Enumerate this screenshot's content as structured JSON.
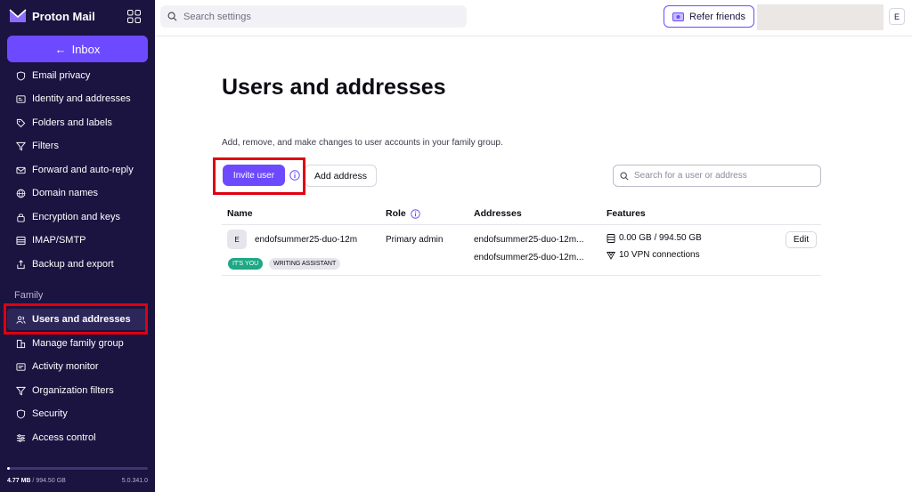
{
  "brand": {
    "name": "Proton Mail"
  },
  "sidebar": {
    "inbox_label": "Inbox",
    "items": [
      {
        "label": "Email privacy",
        "icon": "shield-icon"
      },
      {
        "label": "Identity and addresses",
        "icon": "id-card-icon"
      },
      {
        "label": "Folders and labels",
        "icon": "tag-icon"
      },
      {
        "label": "Filters",
        "icon": "filter-icon"
      },
      {
        "label": "Forward and auto-reply",
        "icon": "envelope-icon"
      },
      {
        "label": "Domain names",
        "icon": "globe-icon"
      },
      {
        "label": "Encryption and keys",
        "icon": "lock-icon"
      },
      {
        "label": "IMAP/SMTP",
        "icon": "server-icon"
      },
      {
        "label": "Backup and export",
        "icon": "export-icon"
      }
    ],
    "family_section_label": "Family",
    "family_items": [
      {
        "label": "Users and addresses",
        "icon": "users-icon",
        "active": true
      },
      {
        "label": "Manage family group",
        "icon": "building-icon"
      },
      {
        "label": "Activity monitor",
        "icon": "monitor-icon"
      },
      {
        "label": "Organization filters",
        "icon": "filter-icon"
      },
      {
        "label": "Security",
        "icon": "shield-icon"
      },
      {
        "label": "Access control",
        "icon": "sliders-icon"
      }
    ],
    "storage": {
      "used": "4.77 MB",
      "separator": " / ",
      "total": "994.50 GB",
      "fraction": 0.005
    },
    "version": "5.0.341.0"
  },
  "topbar": {
    "search_placeholder": "Search settings",
    "refer_label": "Refer friends",
    "avatar_initial": "E"
  },
  "main": {
    "title": "Users and addresses",
    "description": "Add, remove, and make changes to user accounts in your family group.",
    "invite_label": "Invite user",
    "add_address_label": "Add address",
    "user_search_placeholder": "Search for a user or address",
    "columns": {
      "name": "Name",
      "role": "Role",
      "addresses": "Addresses",
      "features": "Features"
    },
    "rows": [
      {
        "avatar": "E",
        "name": "endofsummer25-duo-12m",
        "badges": [
          "IT'S YOU",
          "WRITING ASSISTANT"
        ],
        "role": "Primary admin",
        "addresses": [
          "endofsummer25-duo-12m...",
          "endofsummer25-duo-12m..."
        ],
        "storage": "0.00 GB / 994.50 GB",
        "vpn": "10 VPN connections",
        "edit_label": "Edit"
      }
    ]
  },
  "colors": {
    "sidebar_bg": "#1b1340",
    "accent": "#6d4aff",
    "badge_green": "#1ea885",
    "highlight": "#e0000f"
  }
}
